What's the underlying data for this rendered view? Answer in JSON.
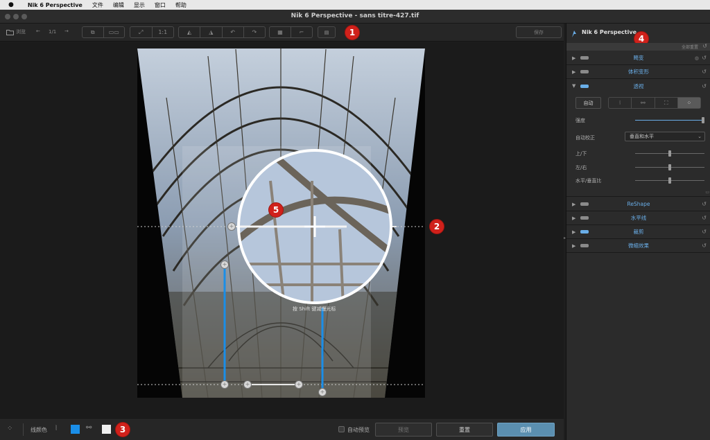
{
  "menubar": {
    "app_name": "Nik 6 Perspective",
    "items": [
      "文件",
      "编辑",
      "显示",
      "窗口",
      "帮助"
    ]
  },
  "window": {
    "title": "Nik 6 Perspective - sans titre-427.tif"
  },
  "toolbar": {
    "browse_label": "浏览",
    "page_counter": "1/1",
    "zoom_label": "1:1",
    "save_label": "保存"
  },
  "panel": {
    "brand": "Nik 6 Perspective",
    "reset_all_label": "全部重置",
    "sections": {
      "distortion": "畸变",
      "volume": "体积变形",
      "perspective": "透视",
      "reshape": "ReShape",
      "horizon": "水平线",
      "crop": "裁剪",
      "tiltshift": "微缩效果"
    },
    "auto_button": "自动",
    "strength_label": "强度",
    "strength_value": 1.0,
    "auto_correct_label": "自动校正",
    "auto_correct_value": "垂直和水平",
    "sliders": [
      {
        "label": "上/下",
        "value": 0.5
      },
      {
        "label": "左/右",
        "value": 0.5
      },
      {
        "label": "水平/垂直比",
        "value": 0.5
      }
    ]
  },
  "canvas": {
    "loupe_hint": "按 Shift 键减慢光标"
  },
  "bottom": {
    "line_color_label": "线颜色",
    "auto_preview_label": "自动预览",
    "preview_button": "预览",
    "reset_button": "重置",
    "apply_button": "应用"
  },
  "badges": [
    "1",
    "2",
    "3",
    "4",
    "5"
  ],
  "colors": {
    "accent_blue": "#1a8ee8",
    "apply_button": "#5b8fb0",
    "badge_red": "#d0211b",
    "link_text": "#6aaee8"
  }
}
